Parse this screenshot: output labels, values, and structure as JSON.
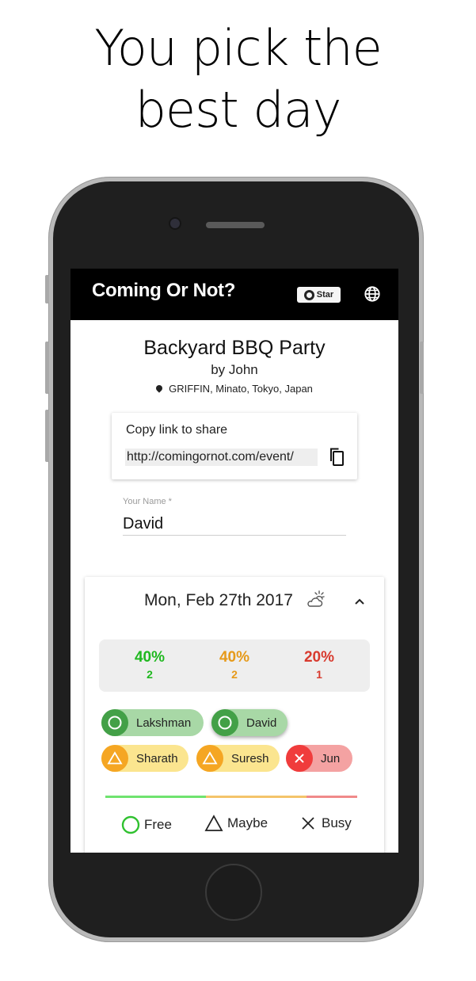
{
  "headline": {
    "line1": "You pick the",
    "line2": "best day"
  },
  "appbar": {
    "title": "Coming Or Not?",
    "star_label": "Star"
  },
  "event": {
    "title": "Backyard BBQ Party",
    "by": "by John",
    "location": "GRIFFIN, Minato, Tokyo, Japan"
  },
  "share": {
    "label": "Copy link to share",
    "link": "http://comingornot.com/event/"
  },
  "name_field": {
    "label": "Your Name *",
    "value": "David"
  },
  "day": {
    "date": "Mon, Feb 27th 2017",
    "stats": [
      {
        "percent": "40%",
        "count": "2",
        "color": "#1fb81f"
      },
      {
        "percent": "40%",
        "count": "2",
        "color": "#e69a1a"
      },
      {
        "percent": "20%",
        "count": "1",
        "color": "#d83a2e"
      }
    ],
    "attendees": [
      {
        "name": "Lakshman",
        "status": "free"
      },
      {
        "name": "David",
        "status": "free"
      },
      {
        "name": "Sharath",
        "status": "maybe"
      },
      {
        "name": "Suresh",
        "status": "maybe"
      },
      {
        "name": "Jun",
        "status": "busy"
      }
    ],
    "bar_colors": [
      "#6fe36f",
      "#f4c46a",
      "#f08a8a"
    ]
  },
  "legend": {
    "free": "Free",
    "maybe": "Maybe",
    "busy": "Busy"
  }
}
